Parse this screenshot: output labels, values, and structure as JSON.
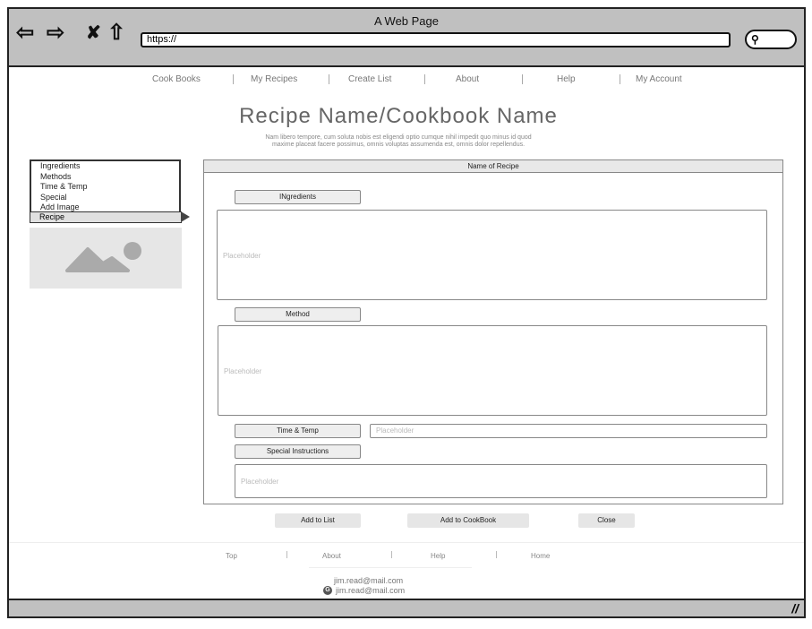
{
  "browser": {
    "title": "A Web Page",
    "url": "https://",
    "icons": [
      "back-arrow-icon",
      "forward-arrow-icon",
      "close-x-icon",
      "home-icon",
      "search-icon"
    ]
  },
  "nav": [
    "Cook Books",
    "My Recipes",
    "Create List",
    "About",
    "Help",
    "My Account"
  ],
  "header": {
    "title": "Recipe Name/Cookbook Name",
    "subtitle_1": "Nam libero tempore, cum soluta nobis est eligendi optio cumque nihil impedit quo minus id quod",
    "subtitle_2": "maxime placeat facere possimus, omnis voluptas assumenda est, omnis dolor repellendus."
  },
  "sidebar": {
    "items": [
      "Ingredients",
      "Methods",
      "Time & Temp",
      "Special",
      "Add Image"
    ],
    "selected": "Recipe"
  },
  "panel": {
    "title": "Name of Recipe",
    "ingredients_label": "INgredients",
    "ingredients_placeholder": "Placeholder",
    "method_label": "Method",
    "method_placeholder": "Placeholder",
    "time_label": "Time & Temp",
    "time_placeholder": "Placeholder",
    "special_label": "Special Instructions",
    "special_placeholder": "Placeholder"
  },
  "actions": {
    "add_list": "Add to List",
    "add_cookbook": "Add to CookBook",
    "close": "Close"
  },
  "footer": {
    "links": [
      "Top",
      "About",
      "Help",
      "Home"
    ],
    "email_1": "jim.read@mail.com",
    "email_2": "jim.read@mail.com"
  }
}
